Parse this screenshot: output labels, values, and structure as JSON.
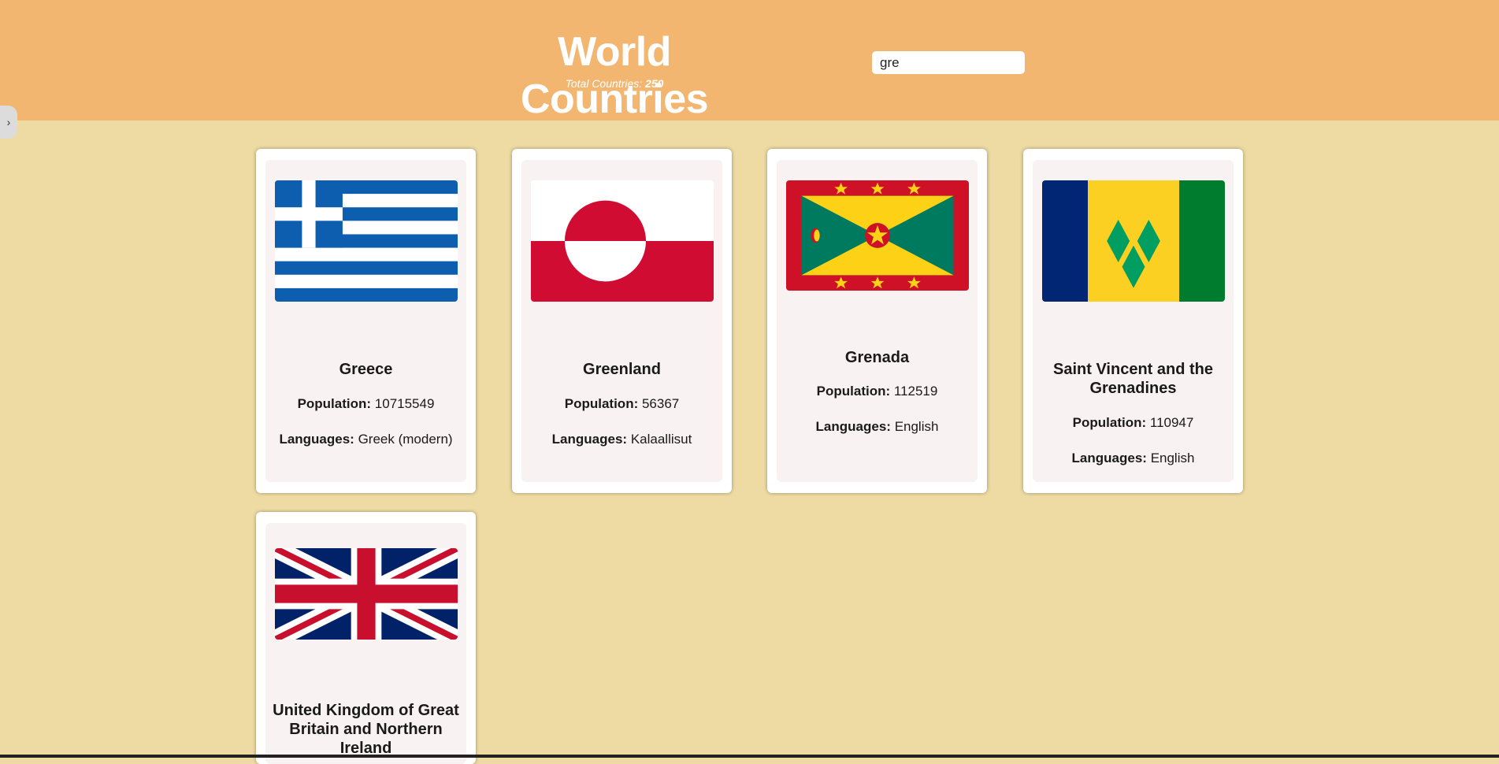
{
  "header": {
    "title": "World Countries",
    "subtitle_label": "Total Countries:",
    "subtitle_count": "250"
  },
  "search": {
    "value": "gre",
    "placeholder": ""
  },
  "sidebar_toggle": {
    "icon": "chevron-right-icon"
  },
  "field_labels": {
    "population": "Population:",
    "languages": "Languages:"
  },
  "countries": [
    {
      "name": "Greece",
      "population": "10715549",
      "languages": "Greek (modern)",
      "flag": "greece-flag"
    },
    {
      "name": "Greenland",
      "population": "56367",
      "languages": "Kalaallisut",
      "flag": "greenland-flag"
    },
    {
      "name": "Grenada",
      "population": "112519",
      "languages": "English",
      "flag": "grenada-flag"
    },
    {
      "name": "Saint Vincent and the Grenadines",
      "population": "110947",
      "languages": "English",
      "flag": "saint-vincent-flag"
    },
    {
      "name": "United Kingdom of Great Britain and Northern Ireland",
      "population": "",
      "languages": "",
      "flag": "uk-flag"
    }
  ],
  "colors": {
    "header_bg": "#f3b670",
    "page_bg": "#eddba3",
    "card_bg": "#ffffff",
    "card_inner_bg": "#f9f2f2"
  }
}
